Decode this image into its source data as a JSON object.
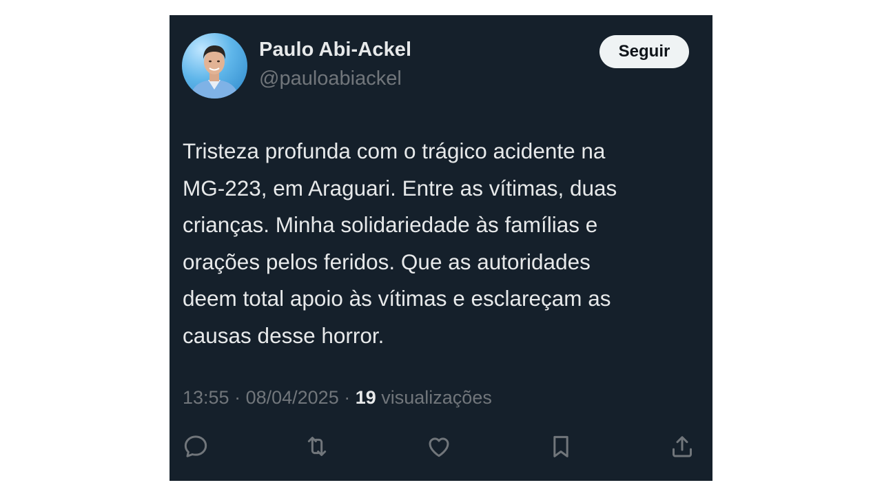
{
  "author": {
    "display_name": "Paulo Abi-Ackel",
    "handle": "@pauloabiackel"
  },
  "follow_button": {
    "label": "Seguir"
  },
  "tweet": {
    "text": "Tristeza profunda com o trágico acidente na\nMG-223, em Araguari. Entre as vítimas, duas\ncrianças. Minha solidariedade às famílias e\norações pelos feridos. Que as autoridades\ndeem total apoio às vítimas e esclareçam as\ncausas desse horror."
  },
  "meta": {
    "time": "13:55",
    "separator": " · ",
    "date": "08/04/2025",
    "views_count": "19",
    "views_label": " visualizações"
  },
  "actions": [
    {
      "name": "reply",
      "icon": "reply-icon"
    },
    {
      "name": "retweet",
      "icon": "retweet-icon"
    },
    {
      "name": "like",
      "icon": "heart-icon"
    },
    {
      "name": "bookmark",
      "icon": "bookmark-icon"
    },
    {
      "name": "share",
      "icon": "share-icon"
    }
  ],
  "colors": {
    "card_background": "#15202b",
    "primary_text": "#e7e9ea",
    "secondary_text": "#71767b",
    "button_background": "#eff3f4"
  }
}
